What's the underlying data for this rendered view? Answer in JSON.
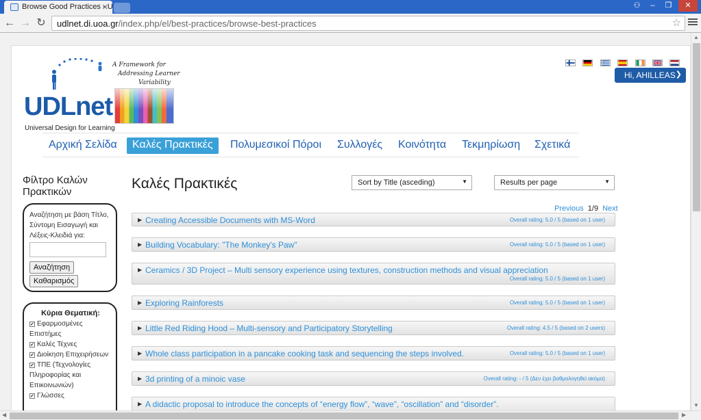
{
  "browser": {
    "tab_title": "Browse Good Practices - U",
    "url_host": "udlnet.di.uoa.gr",
    "url_path": "/index.php/el/best-practices/browse-best-practices",
    "winctl": [
      "–",
      "❐",
      "✕"
    ]
  },
  "logo": {
    "word": "UDLnet",
    "subtitle": "Universal Design for Learning",
    "tagline": [
      "A Framework for",
      "Addressing Learner",
      "Variability"
    ]
  },
  "user": {
    "greeting": "Hi, AHILLEAS",
    "languages": [
      "fi",
      "de",
      "el",
      "es",
      "ie",
      "gb",
      "nl"
    ]
  },
  "nav": [
    "Αρχική Σελίδα",
    "Καλές Πρακτικές",
    "Πολυμεσικοί Πόροι",
    "Συλλογές",
    "Κοινότητα",
    "Τεκμηρίωση",
    "Σχετικά"
  ],
  "sidebar": {
    "title": "Φίλτρο Καλών Πρακτικών",
    "search_label": "Αναζήτηση με βάση Τίτλο, Σύντομη Εισαγωγή και Λέξεις-Κλειδιά για:",
    "search_value": "",
    "search_button": "Αναζήτηση",
    "clear_button": "Καθαρισμός",
    "topics_head": "Κύρια Θεματική:",
    "topics": [
      {
        "label": "Εφαρμοσμένες Επιστήμες",
        "checked": true
      },
      {
        "label": "Καλές Τέχνες",
        "checked": true
      },
      {
        "label": "Διοίκηση Επιχειρήσεων",
        "checked": true
      },
      {
        "label": "ΤΠΕ (Τεχνολογίες Πληροφορίας και Επικοινωνιών)",
        "checked": true
      },
      {
        "label": "Γλώσσες",
        "checked": true
      }
    ]
  },
  "content": {
    "title": "Καλές Πρακτικές",
    "sort_select": "Sort by Title (asceding)",
    "results_select": "Results per page",
    "pager": {
      "previous": "Previous",
      "current": "1/9",
      "next": "Next"
    },
    "results": [
      {
        "title": "Creating Accessible Documents with MS-Word",
        "rating": "Overall rating: 5.0 / 5 (based on 1 user)"
      },
      {
        "title": "Building Vocabulary: \"The Monkey's Paw\"",
        "rating": "Overall rating: 5.0 / 5 (based on 1 user)"
      },
      {
        "title": "Ceramics / 3D Project – Multi sensory experience using textures, construction methods and visual appreciation",
        "rating": "Overall rating: 5.0 / 5 (based on 1 user)"
      },
      {
        "title": "Exploring Rainforests",
        "rating": "Overall rating: 5.0 / 5 (based on 1 user)"
      },
      {
        "title": "Little Red Riding Hood – Multi-sensory and Participatory Storytelling",
        "rating": "Overall rating: 4.5 / 5 (based on 2 users)"
      },
      {
        "title": "Whole class participation in a pancake cooking task and sequencing the steps involved.",
        "rating": "Overall rating: 5.0 / 5 (based on 1 user)"
      },
      {
        "title": "3d printing of a minoic vase",
        "rating": "Overall rating: - / 5 (Δεν έχει βαθμολογηθεί ακόμα)"
      },
      {
        "title": "A didactic proposal to introduce the concepts of “energy flow”, “wave”, “oscillation” and “disorder”.",
        "rating": ""
      }
    ]
  }
}
